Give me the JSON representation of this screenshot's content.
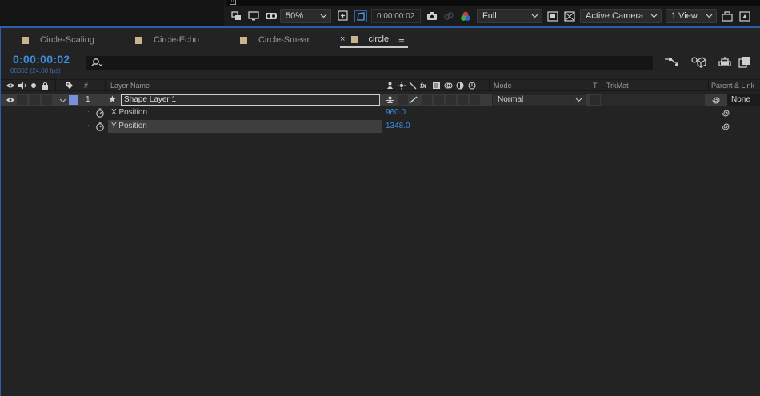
{
  "viewer_toolbar": {
    "zoom": "50%",
    "timecode": "0:00:00:02",
    "resolution": "Full",
    "camera": "Active Camera",
    "views": "1 View",
    "ruler_mark": "0"
  },
  "tabs": [
    {
      "label": "Circle-Scaling",
      "active": false
    },
    {
      "label": "Circle-Echo",
      "active": false
    },
    {
      "label": "Circle-Smear",
      "active": false
    },
    {
      "label": "circle",
      "active": true
    }
  ],
  "tab_close": "×",
  "tab_menu": "≡",
  "timeline": {
    "current_time": "0:00:00:02",
    "frame_info": "00002 (24.00 fps)"
  },
  "columns": {
    "number": "#",
    "layer_name": "Layer Name",
    "mode": "Mode",
    "t": "T",
    "trkmat": "TrkMat",
    "parent": "Parent & Link"
  },
  "layer": {
    "index": "1",
    "name": "Shape Layer 1",
    "mode": "Normal",
    "parent": "None",
    "label_color": "#7b8fe0"
  },
  "properties": [
    {
      "name": "X Position",
      "value": "960.0"
    },
    {
      "name": "Y Position",
      "value": "1348.0"
    }
  ],
  "colors": {
    "accent_blue": "#3d8ee0",
    "panel_bg": "#232323",
    "focus_border": "#2c5fa8"
  }
}
